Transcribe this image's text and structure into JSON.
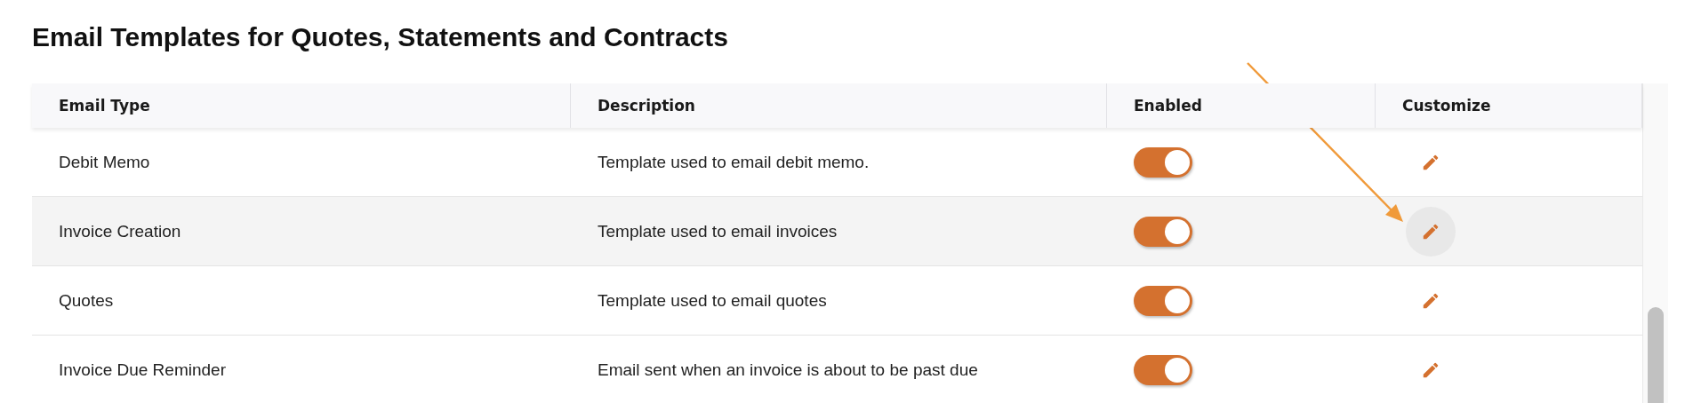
{
  "title": "Email Templates for Quotes, Statements and Contracts",
  "table": {
    "columns": [
      "Email Type",
      "Description",
      "Enabled",
      "Customize"
    ],
    "rows": [
      {
        "email_type": "Debit Memo",
        "description": "Template used to email debit memo.",
        "enabled": true,
        "highlighted": false
      },
      {
        "email_type": "Invoice Creation",
        "description": "Template used to email invoices",
        "enabled": true,
        "highlighted": true
      },
      {
        "email_type": "Quotes",
        "description": "Template used to email quotes",
        "enabled": true,
        "highlighted": false
      },
      {
        "email_type": "Invoice Due Reminder",
        "description": "Email sent when an invoice is about to be past due",
        "enabled": true,
        "highlighted": false
      }
    ]
  }
}
